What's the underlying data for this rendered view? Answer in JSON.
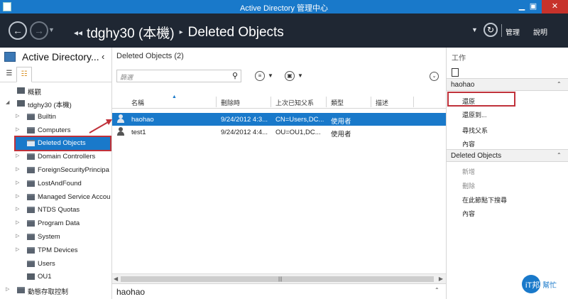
{
  "window": {
    "title": "Active Directory 管理中心",
    "minimize": "▁",
    "maximize": "▣",
    "close": "✕"
  },
  "nav": {
    "crumbs": [
      "tdghy30 (本機)",
      "Deleted Objects"
    ],
    "manage": "管理",
    "help": "說明"
  },
  "left": {
    "title": "Active Directory...",
    "tree": [
      {
        "label": "概觀",
        "icon": "overview-icon",
        "exp": ""
      },
      {
        "label": "tdghy30 (本機)",
        "icon": "domain-icon",
        "exp": "◢"
      },
      {
        "label": "Builtin",
        "icon": "folder-icon",
        "exp": "▷"
      },
      {
        "label": "Computers",
        "icon": "folder-icon",
        "exp": "▷"
      },
      {
        "label": "Deleted Objects",
        "icon": "folder-icon",
        "exp": ""
      },
      {
        "label": "Domain Controllers",
        "icon": "folder-icon",
        "exp": "▷"
      },
      {
        "label": "ForeignSecurityPrincipa",
        "icon": "folder-icon",
        "exp": "▷"
      },
      {
        "label": "LostAndFound",
        "icon": "folder-icon",
        "exp": "▷"
      },
      {
        "label": "Managed Service Accou",
        "icon": "folder-icon",
        "exp": "▷"
      },
      {
        "label": "NTDS Quotas",
        "icon": "folder-icon",
        "exp": "▷"
      },
      {
        "label": "Program Data",
        "icon": "folder-icon",
        "exp": "▷"
      },
      {
        "label": "System",
        "icon": "folder-icon",
        "exp": "▷"
      },
      {
        "label": "TPM Devices",
        "icon": "folder-icon",
        "exp": "▷"
      },
      {
        "label": "Users",
        "icon": "folder-icon",
        "exp": ""
      },
      {
        "label": "OU1",
        "icon": "ou-icon",
        "exp": ""
      },
      {
        "label": "動態存取控制",
        "icon": "folder-icon",
        "exp": "▷"
      }
    ]
  },
  "middle": {
    "title": "Deleted Objects  (2)",
    "filter_placeholder": "篩選",
    "columns": [
      "名稱",
      "刪除時",
      "上次已知父系",
      "類型",
      "描述"
    ],
    "rows": [
      {
        "name": "haohao",
        "deleted": "9/24/2012 4:3...",
        "parent": "CN=Users,DC...",
        "type": "使用者",
        "desc": ""
      },
      {
        "name": "test1",
        "deleted": "9/24/2012 4:4...",
        "parent": "OU=OU1,DC...",
        "type": "使用者",
        "desc": ""
      }
    ],
    "status": "haohao"
  },
  "right": {
    "header": "工作",
    "sections": [
      {
        "title": "haohao",
        "tasks": [
          "還原",
          "還原到...",
          "尋找父系",
          "內容"
        ]
      },
      {
        "title": "Deleted Objects",
        "tasks": [
          "新增",
          "刪除",
          "在此節點下搜尋",
          "內容"
        ]
      }
    ]
  },
  "watermark": {
    "text1": "iT邦",
    "text2": "幫忙"
  },
  "colors": {
    "accent": "#1979ca",
    "nav_bg": "#1f2733",
    "highlight_border": "#c0313a"
  }
}
